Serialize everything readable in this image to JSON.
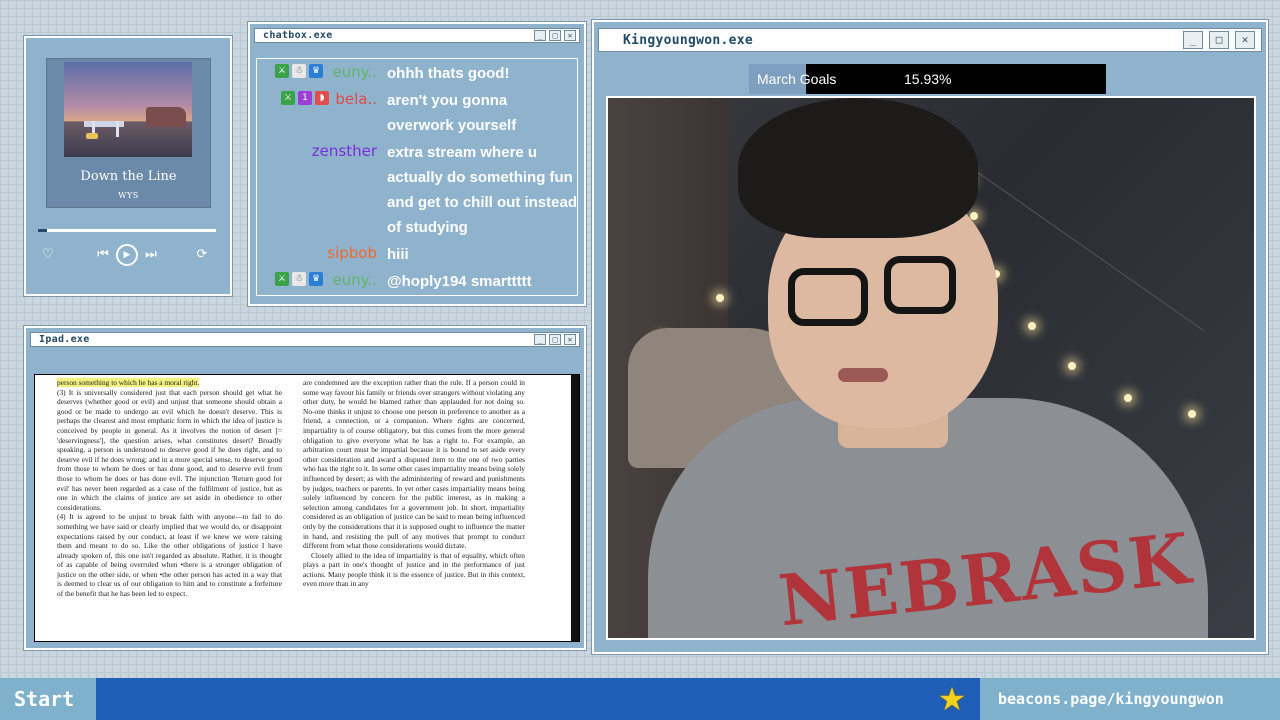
{
  "music": {
    "title": "Down the Line",
    "artist": "WYS",
    "progress": 0.05,
    "controls": {
      "like_icon": "heart-icon",
      "prev_icon": "skip-back-icon",
      "play_icon": "play-icon",
      "next_icon": "skip-forward-icon",
      "repeat_icon": "repeat-icon"
    }
  },
  "chatbox": {
    "title": "chatbox.exe",
    "messages": [
      {
        "user": "euny..",
        "text": "ohhh thats good!",
        "color": "#5fb36a",
        "badges": [
          "sword",
          "ghost",
          "crown"
        ]
      },
      {
        "user": "bela..",
        "text": "aren't you gonna overwork yourself",
        "color": "#e04a4a",
        "badges": [
          "sword",
          "sub",
          "melon"
        ]
      },
      {
        "user": "zensther",
        "text": "extra stream where u actually do something fun and get to chill out instead of studying",
        "color": "#7a2fd6",
        "badges": []
      },
      {
        "user": "sipbob",
        "text": "hiii",
        "color": "#f06a2a",
        "badges": []
      },
      {
        "user": "euny..",
        "text": "@hoply194 smarttttt",
        "color": "#5fb36a",
        "badges": [
          "sword",
          "ghost",
          "crown"
        ]
      }
    ]
  },
  "ipad": {
    "title": "Ipad.exe",
    "left_col": [
      "person something to which he has a moral right.",
      "(3) It is universally considered just that each person should get what he deserves (whether good or evil) and unjust that someone should obtain a good or be made to undergo an evil which he doesn't deserve. This is perhaps the clearest and most emphatic form in which the idea of justice is conceived by people in general. As it involves the notion of desert [= 'deservingness'], the question arises, what constitutes desert? Broadly speaking, a person is understood to deserve good if he does right, and to deserve evil if he does wrong; and in a more special sense, to deserve good from those to whom he does or has done good, and to deserve evil from those to whom he does or has done evil. The injunction 'Return good for evil' has never been regarded as a case of the fulfilment of justice, but as one in which the claims of justice are set aside in obedience to other considerations.",
      "(4) It is agreed to be unjust to break faith with anyone—to fail to do something we have said or clearly implied that we would do, or disappoint expectations raised by our conduct, at least if we knew we were raising them and meant to do so. Like the other obligations of justice I have already spoken of, this one isn't regarded as absolute. Rather, it is thought of as capable of being overruled when •there is a stronger obligation of justice on the other side, or when •the other person has acted in a way that is deemed to clear us of our obligation to him and to constitute a forfeiture of the benefit that he has been led to expect."
    ],
    "right_col": [
      "are condemned are the exception rather than the rule. If a person could in some way favour his family or friends over strangers without violating any other duty, he would be blamed rather than applauded for not doing so. No-one thinks it unjust to choose one person in preference to another as a friend, a connection, or a companion. Where rights are concerned, impartiality is of course obligatory, but this comes from the more general obligation to give everyone what he has a right to. For example, an arbitration court must be impartial because it is bound to set aside every other consideration and award a disputed item to the one of two parties who has the right to it. In some other cases impartiality means being solely influenced by desert; as with the administering of reward and punishments by judges, teachers or parents. In yet other cases impartiality means being solely influenced by concern for the public interest, as in making a selection among candidates for a government job. In short, impartiality considered as an obligation of justice can be said to mean being influenced only by the considerations that it is supposed ought to influence the matter in hand, and resisting the pull of any motives that prompt to conduct different from what those considerations would dictate.",
      "Closely allied to the idea of impartiality is that of equality, which often plays a part in one's thought of justice and in the performance of just actions. Many people think it is the essence of justice. But in this context, even more than in any"
    ]
  },
  "stream": {
    "title": "Kingyoungwon.exe",
    "goal_label": "March Goals",
    "goal_percent": "15.93%",
    "goal_fraction": 0.1593
  },
  "taskbar": {
    "start_label": "Start",
    "tray_icon": "star-icon",
    "link": "beacons.page/kingyoungwon"
  },
  "colors": {
    "window_bg": "#8fb3cc",
    "taskbar": "#1f5fb8",
    "accent": "#7fb0cc"
  }
}
